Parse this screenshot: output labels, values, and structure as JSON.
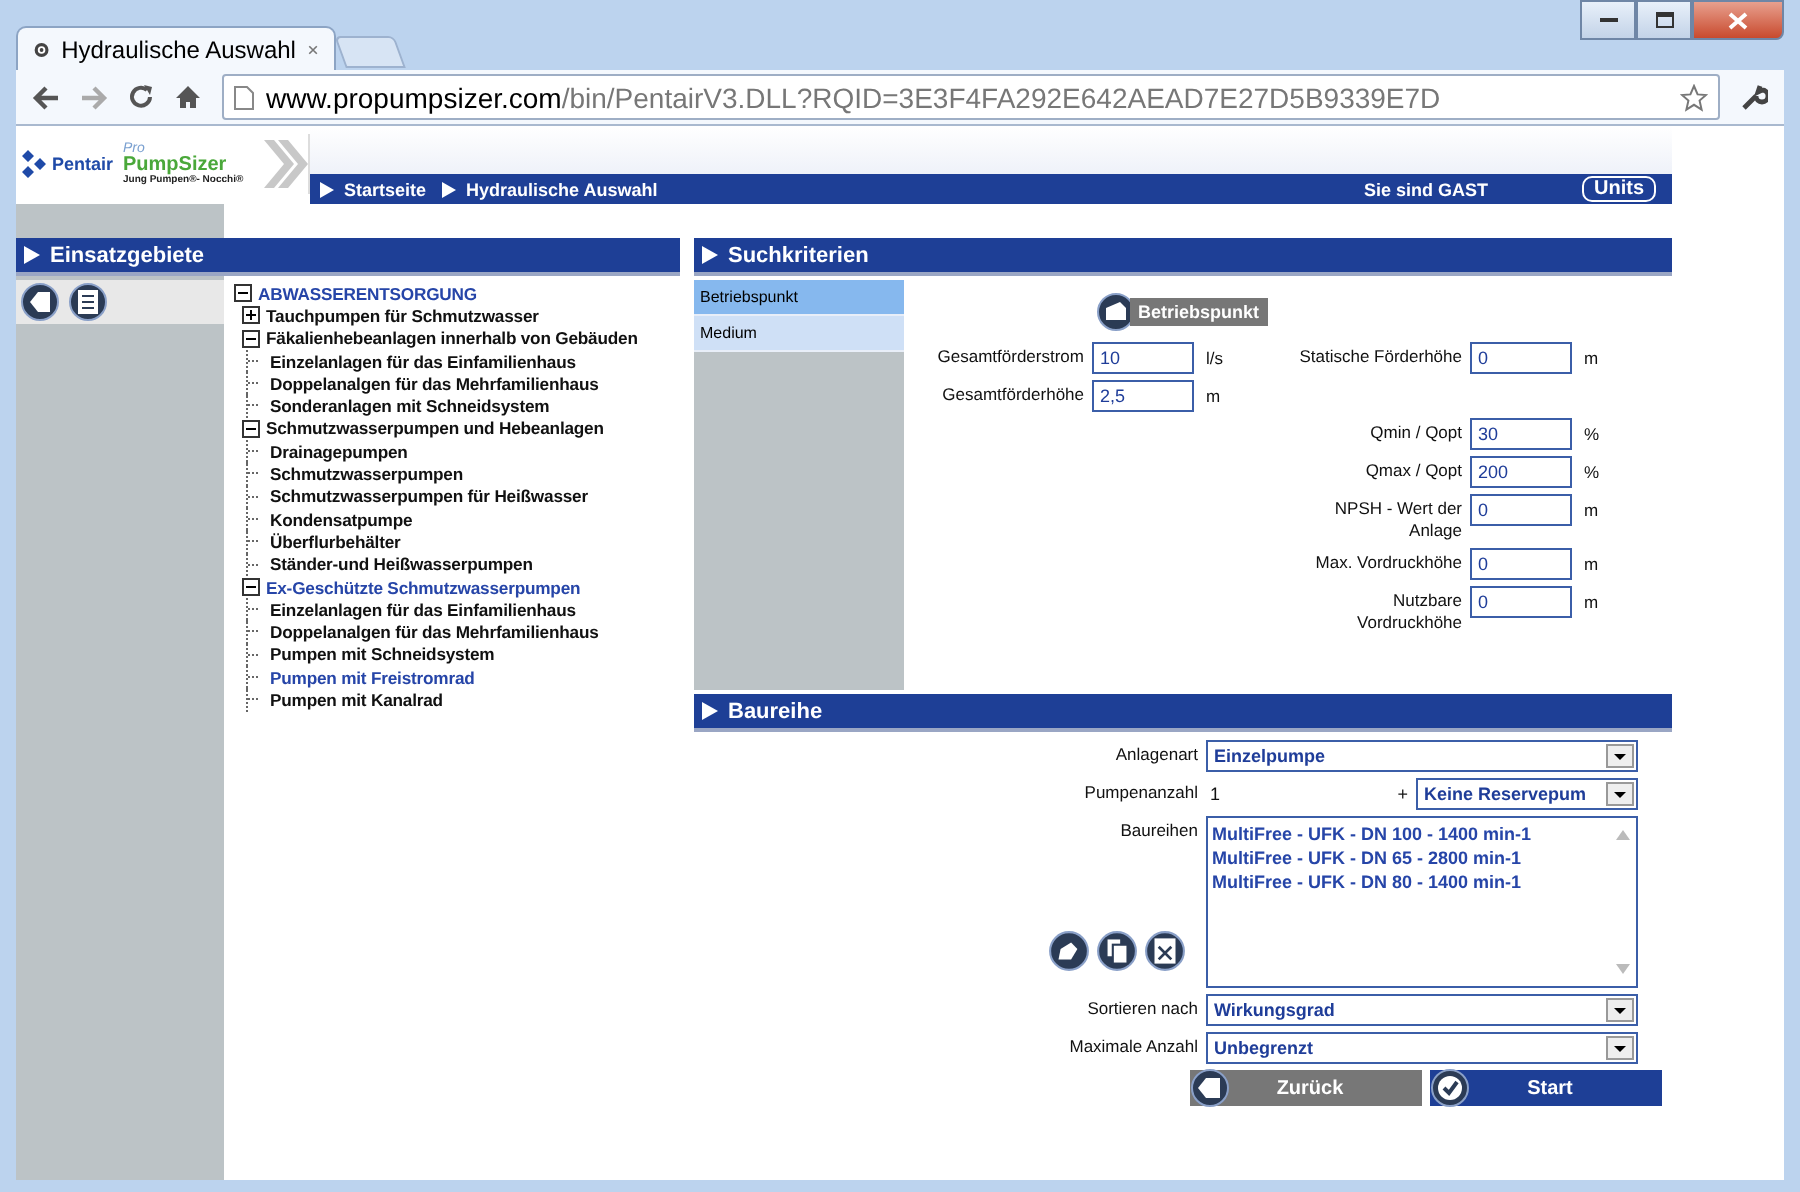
{
  "window": {
    "tab_title": "Hydraulische Auswahl",
    "url_host": "www.propumpsizer.com",
    "url_path": "/bin/PentairV3.DLL?RQID=3E3F4FA292E642AEAD7E27D5B9339E7D"
  },
  "logo": {
    "brand": "Pentair",
    "product_prefix": "Pro",
    "product": "PumpSizer",
    "tagline": "Jung Pumpen®- Nocchi®"
  },
  "breadcrumb": [
    "Startseite",
    "Hydraulische Auswahl"
  ],
  "user_status": "Sie sind GAST",
  "units_button": "Units",
  "sidebar": {
    "title": "Einsatzgebiete",
    "tree": [
      {
        "label": "ABWASSERENTSORGUNG",
        "kind": "folder",
        "expanded": true,
        "selected": true,
        "children": [
          {
            "label": "Tauchpumpen für Schmutzwasser",
            "kind": "folder",
            "expanded": false,
            "selected": false
          },
          {
            "label": "Fäkalienhebeanlagen innerhalb von Gebäuden",
            "kind": "folder",
            "expanded": true,
            "selected": false,
            "children": [
              {
                "label": "Einzelanlagen für das Einfamilienhaus",
                "kind": "leaf",
                "selected": false
              },
              {
                "label": "Doppelanalgen für das Mehrfamilienhaus",
                "kind": "leaf",
                "selected": false
              },
              {
                "label": "Sonderanlagen mit Schneidsystem",
                "kind": "leaf",
                "selected": false
              }
            ]
          },
          {
            "label": "Schmutzwasserpumpen und Hebeanlagen",
            "kind": "folder",
            "expanded": true,
            "selected": false,
            "children": [
              {
                "label": "Drainagepumpen",
                "kind": "leaf",
                "selected": false
              },
              {
                "label": "Schmutzwasserpumpen",
                "kind": "leaf",
                "selected": false
              },
              {
                "label": "Schmutzwasserpumpen für Heißwasser",
                "kind": "leaf",
                "selected": false
              },
              {
                "label": "Kondensatpumpe",
                "kind": "leaf",
                "selected": false
              },
              {
                "label": "Überflurbehälter",
                "kind": "leaf",
                "selected": false
              },
              {
                "label": "Ständer-und Heißwasserpumpen",
                "kind": "leaf",
                "selected": false
              }
            ]
          },
          {
            "label": "Ex-Geschützte Schmutzwasserpumpen",
            "kind": "folder",
            "expanded": true,
            "selected": true,
            "children": [
              {
                "label": "Einzelanlagen für das Einfamilienhaus",
                "kind": "leaf",
                "selected": false
              },
              {
                "label": "Doppelanalgen für das Mehrfamilienhaus",
                "kind": "leaf",
                "selected": false
              },
              {
                "label": "Pumpen mit Schneidsystem",
                "kind": "leaf",
                "selected": false
              },
              {
                "label": "Pumpen mit Freistromrad",
                "kind": "leaf",
                "selected": true
              },
              {
                "label": "Pumpen mit Kanalrad",
                "kind": "leaf",
                "selected": false
              }
            ]
          }
        ]
      }
    ]
  },
  "criteria": {
    "title": "Suchkriterien",
    "tabs": [
      {
        "label": "Betriebspunkt",
        "selected": true
      },
      {
        "label": "Medium",
        "selected": false
      }
    ],
    "badge": "Betriebspunkt",
    "rows": [
      {
        "left": {
          "label": "Gesamtförderstrom",
          "value": "10",
          "unit": "l/s"
        },
        "right": {
          "label": "Statische Förderhöhe",
          "value": "0",
          "unit": "m"
        }
      },
      {
        "left": {
          "label": "Gesamtförderhöhe",
          "value": "2,5",
          "unit": "m"
        }
      },
      {
        "right": {
          "label": "Qmin / Qopt",
          "value": "30",
          "unit": "%"
        }
      },
      {
        "right": {
          "label": "Qmax / Qopt",
          "value": "200",
          "unit": "%"
        }
      },
      {
        "right": {
          "label": "NPSH - Wert der Anlage",
          "value": "0",
          "unit": "m"
        }
      },
      {
        "right": {
          "label": "Max. Vordruckhöhe",
          "value": "0",
          "unit": "m"
        }
      },
      {
        "right": {
          "label": "Nutzbare Vordruckhöhe",
          "value": "0",
          "unit": "m"
        }
      }
    ]
  },
  "series": {
    "title": "Baureihe",
    "system_type": {
      "label": "Anlagenart",
      "value": "Einzelpumpe"
    },
    "pump_count": {
      "label": "Pumpenanzahl",
      "value": "1",
      "plus": "+",
      "reserve": "Keine Reservepum"
    },
    "series_list": {
      "label": "Baureihen",
      "items": [
        "MultiFree - UFK - DN 100 - 1400 min-1",
        "MultiFree - UFK - DN 65 - 2800 min-1",
        "MultiFree - UFK - DN 80 - 1400 min-1"
      ]
    },
    "sort": {
      "label": "Sortieren nach",
      "value": "Wirkungsgrad"
    },
    "max_count": {
      "label": "Maximale Anzahl",
      "value": "Unbegrenzt"
    },
    "buttons": [
      {
        "label": "Zurück",
        "kind": "back"
      },
      {
        "label": "Start",
        "kind": "start"
      }
    ]
  }
}
